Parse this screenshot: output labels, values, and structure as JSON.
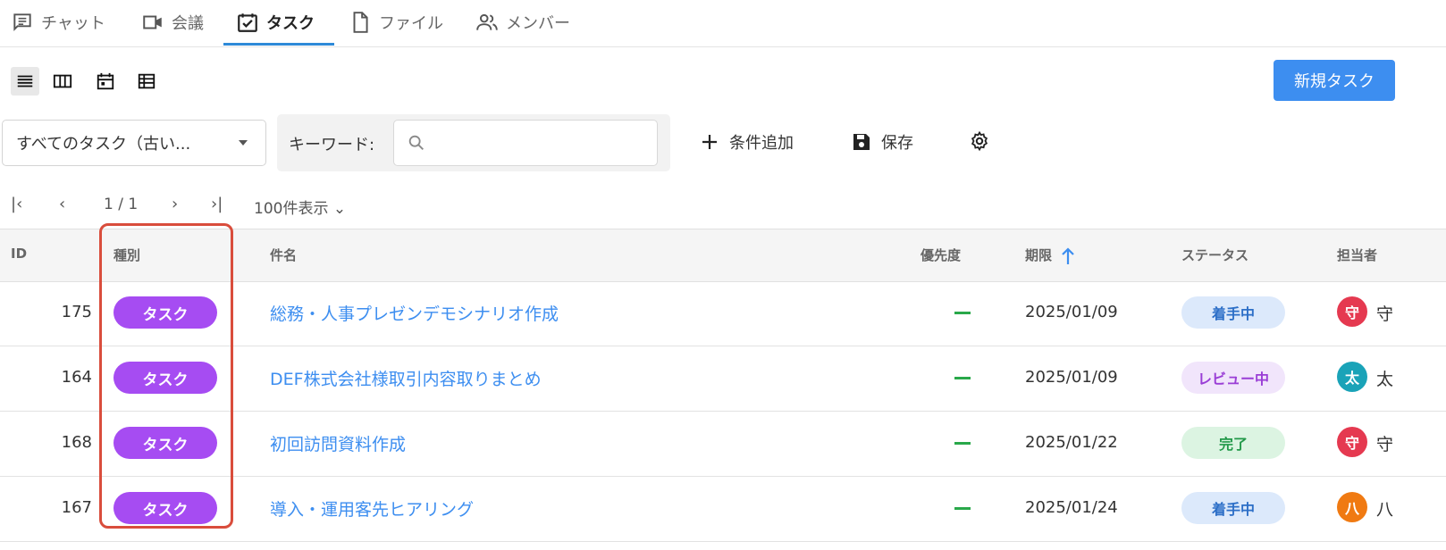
{
  "tabs": [
    {
      "label": "チャット",
      "icon": "chat-icon",
      "active": false
    },
    {
      "label": "会議",
      "icon": "video-icon",
      "active": false
    },
    {
      "label": "タスク",
      "icon": "task-check-icon",
      "active": true
    },
    {
      "label": "ファイル",
      "icon": "file-icon",
      "active": false
    },
    {
      "label": "メンバー",
      "icon": "members-icon",
      "active": false
    }
  ],
  "views": [
    "list-view-icon",
    "board-view-icon",
    "calendar-view-icon",
    "table-view-icon"
  ],
  "toolbar": {
    "new_task_label": "新規タスク"
  },
  "filter": {
    "selected": "すべてのタスク（古い...",
    "keyword_label": "キーワード:",
    "keyword_value": "",
    "add_condition": "条件追加",
    "save": "保存"
  },
  "pager": {
    "page": "1 / 1",
    "per_page": "100件表示"
  },
  "columns": {
    "id": "ID",
    "type": "種別",
    "subject": "件名",
    "priority": "優先度",
    "due": "期限",
    "status": "ステータス",
    "assignee": "担当者"
  },
  "rows": [
    {
      "id": "175",
      "type": "タスク",
      "subject": "総務・人事プレゼンデモシナリオ作成",
      "due": "2025/01/09",
      "status": "着手中",
      "avatar": "守",
      "assignee": "守"
    },
    {
      "id": "164",
      "type": "タスク",
      "subject": "DEF株式会社様取引内容取りまとめ",
      "due": "2025/01/09",
      "status": "レビュー中",
      "avatar": "太",
      "assignee": "太"
    },
    {
      "id": "168",
      "type": "タスク",
      "subject": "初回訪問資料作成",
      "due": "2025/01/22",
      "status": "完了",
      "avatar": "守",
      "assignee": "守"
    },
    {
      "id": "167",
      "type": "タスク",
      "subject": "導入・運用客先ヒアリング",
      "due": "2025/01/24",
      "status": "着手中",
      "avatar": "八",
      "assignee": "八"
    }
  ],
  "colors": {
    "accent": "#3d8ef0",
    "type_badge": "#a64cf2",
    "status_in_progress_bg": "#dce9fb",
    "status_in_progress_fg": "#2d6fc7",
    "status_review_bg": "#f1e5fb",
    "status_review_fg": "#9a3ed6",
    "status_done_bg": "#dcf4e2",
    "status_done_fg": "#23994a",
    "avatar_red": "#e53950",
    "avatar_teal": "#1aa3b8",
    "avatar_orange": "#f07a12",
    "highlight": "#d94d3c"
  }
}
